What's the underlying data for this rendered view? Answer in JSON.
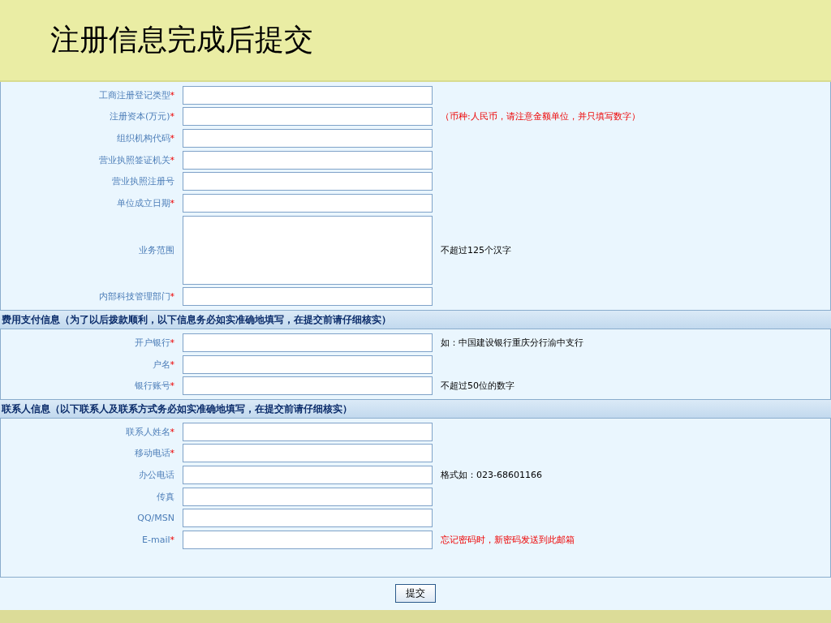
{
  "title": "注册信息完成后提交",
  "sections": [
    {
      "rows": [
        {
          "label": "工商注册登记类型",
          "required": true,
          "kind": "input"
        },
        {
          "label": "注册资本(万元)",
          "required": true,
          "kind": "input",
          "note": {
            "text": "（币种:人民币，请注意金额单位，并只填写数字）",
            "warning": true
          }
        },
        {
          "label": "组织机构代码",
          "required": true,
          "kind": "input"
        },
        {
          "label": "营业执照签证机关",
          "required": true,
          "kind": "input"
        },
        {
          "label": "营业执照注册号",
          "required": false,
          "kind": "input"
        },
        {
          "label": "单位成立日期",
          "required": true,
          "kind": "input"
        },
        {
          "label": "业务范围",
          "required": false,
          "kind": "textarea",
          "note": {
            "text": "不超过125个汉字",
            "warning": false
          }
        },
        {
          "label": "内部科技管理部门",
          "required": true,
          "kind": "input"
        }
      ]
    },
    {
      "header": "费用支付信息（为了以后拨款顺利，以下信息务必如实准确地填写，在提交前请仔细核实）",
      "rows": [
        {
          "label": "开户银行",
          "required": true,
          "kind": "input",
          "note": {
            "text": "如：中国建设银行重庆分行渝中支行",
            "warning": false
          }
        },
        {
          "label": "户名",
          "required": true,
          "kind": "input"
        },
        {
          "label": "银行账号",
          "required": true,
          "kind": "input",
          "note": {
            "text": "不超过50位的数字",
            "warning": false
          }
        }
      ]
    },
    {
      "header": "联系人信息（以下联系人及联系方式务必如实准确地填写，在提交前请仔细核实）",
      "rows": [
        {
          "label": "联系人姓名",
          "required": true,
          "kind": "input"
        },
        {
          "label": "移动电话",
          "required": true,
          "kind": "input"
        },
        {
          "label": "办公电话",
          "required": false,
          "kind": "input",
          "note": {
            "text": "格式如：023-68601166",
            "warning": false
          }
        },
        {
          "label": "传真",
          "required": false,
          "kind": "input"
        },
        {
          "label": "QQ/MSN",
          "required": false,
          "kind": "input"
        },
        {
          "label": "E-mail",
          "required": true,
          "kind": "input",
          "note": {
            "text": "忘记密码时，新密码发送到此邮箱",
            "warning": true
          }
        }
      ]
    }
  ],
  "required_mark": "*",
  "submit": "提交"
}
